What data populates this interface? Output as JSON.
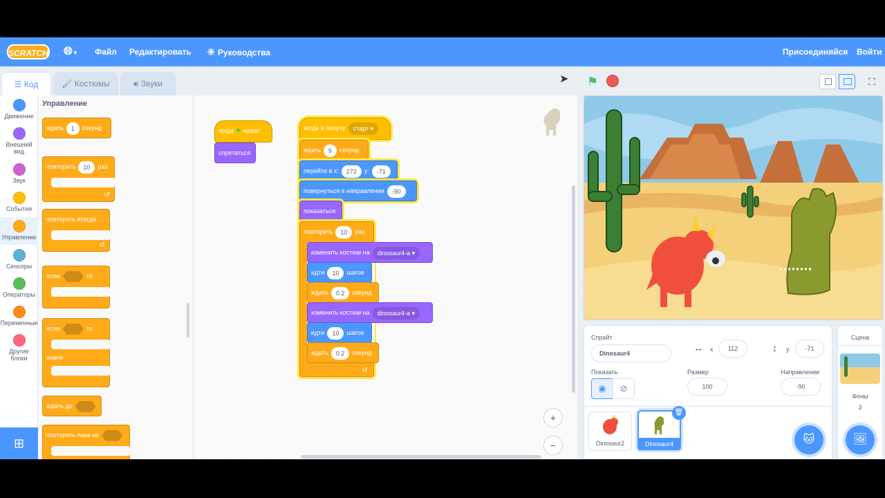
{
  "menu": {
    "logo": "SCRATCH",
    "file": "Файл",
    "edit": "Редактировать",
    "tutorials": "Руководства",
    "join": "Присоединяйся",
    "signin": "Войти"
  },
  "tabs": {
    "code": "Код",
    "costumes": "Костюмы",
    "sounds": "Звуки"
  },
  "categories": [
    {
      "label": "Движение",
      "color": "#4c97ff"
    },
    {
      "label": "Внешний вид",
      "color": "#9966ff"
    },
    {
      "label": "Звук",
      "color": "#cf63cf"
    },
    {
      "label": "События",
      "color": "#ffbf00"
    },
    {
      "label": "Управление",
      "color": "#ffab19"
    },
    {
      "label": "Сенсоры",
      "color": "#5cb1d6"
    },
    {
      "label": "Операторы",
      "color": "#59c059"
    },
    {
      "label": "Переменные",
      "color": "#ff8c1a"
    },
    {
      "label": "Другие блоки",
      "color": "#ff6680"
    }
  ],
  "palette": {
    "title": "Управление",
    "wait": {
      "pre": "ждать",
      "val": "1",
      "post": "секунд"
    },
    "repeat": {
      "pre": "повторить",
      "val": "10",
      "post": "раз"
    },
    "forever": "повторять всегда",
    "if": {
      "pre": "если",
      "post": "то"
    },
    "ifelse": {
      "pre": "если",
      "post": "то",
      "else": "иначе"
    },
    "waituntil": "ждать до",
    "repeatuntil": "повторять пока не"
  },
  "script1": {
    "hat": {
      "pre": "когда",
      "post": "нажат"
    },
    "hide": "спрятаться"
  },
  "script2": {
    "hat": {
      "pre": "когда я получу",
      "msg": "старт"
    },
    "wait": {
      "pre": "ждать",
      "val": "9",
      "post": "секунд"
    },
    "goto": {
      "pre": "перейти в x:",
      "x": "272",
      "ylabel": "y:",
      "y": "-71"
    },
    "point": {
      "pre": "повернуться в направлении",
      "val": "-90"
    },
    "show": "показаться",
    "repeat": {
      "pre": "повторить",
      "val": "10",
      "post": "раз"
    },
    "costume1": {
      "pre": "изменить костюм на",
      "val": "dinosaur4-a"
    },
    "move1": {
      "pre": "идти",
      "val": "10",
      "post": "шагов"
    },
    "wait1": {
      "pre": "ждать",
      "val": "0.2",
      "post": "секунд"
    },
    "costume2": {
      "pre": "изменить костюм на",
      "val": "dinosaur4-a"
    },
    "move2": {
      "pre": "идти",
      "val": "10",
      "post": "шагов"
    },
    "wait2": {
      "pre": "ждать",
      "val": "0.2",
      "post": "секунд"
    }
  },
  "zoom": {
    "in": "+",
    "out": "−",
    "reset": "="
  },
  "sprite": {
    "label": "Спрайт",
    "name": "Dinosaur4",
    "xlabel": "x",
    "x": "112",
    "ylabel": "y",
    "y": "-71",
    "show_label": "Показать",
    "size_label": "Размер",
    "size": "100",
    "dir_label": "Направление",
    "dir": "-90",
    "thumbs": [
      {
        "name": "Dinosaur2"
      },
      {
        "name": "Dinosaur4"
      }
    ]
  },
  "stagepanel": {
    "title": "Сцена",
    "backdrops_label": "Фоны",
    "backdrops": "3"
  }
}
